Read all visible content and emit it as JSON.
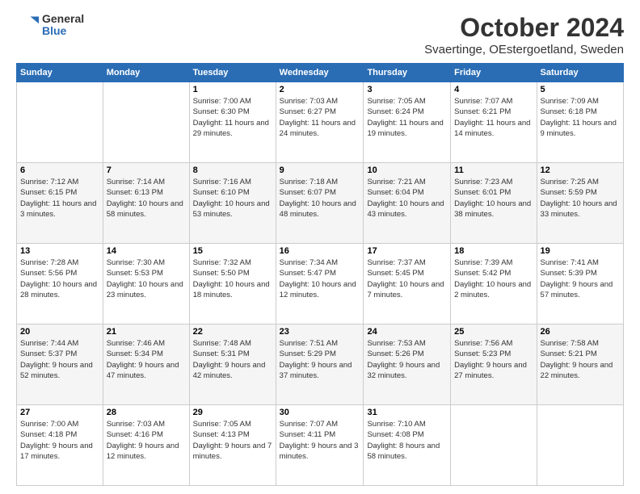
{
  "logo": {
    "general": "General",
    "blue": "Blue"
  },
  "title": "October 2024",
  "subtitle": "Svaertinge, OEstergoetland, Sweden",
  "days_header": [
    "Sunday",
    "Monday",
    "Tuesday",
    "Wednesday",
    "Thursday",
    "Friday",
    "Saturday"
  ],
  "weeks": [
    [
      {
        "num": "",
        "sunrise": "",
        "sunset": "",
        "daylight": ""
      },
      {
        "num": "",
        "sunrise": "",
        "sunset": "",
        "daylight": ""
      },
      {
        "num": "1",
        "sunrise": "Sunrise: 7:00 AM",
        "sunset": "Sunset: 6:30 PM",
        "daylight": "Daylight: 11 hours and 29 minutes."
      },
      {
        "num": "2",
        "sunrise": "Sunrise: 7:03 AM",
        "sunset": "Sunset: 6:27 PM",
        "daylight": "Daylight: 11 hours and 24 minutes."
      },
      {
        "num": "3",
        "sunrise": "Sunrise: 7:05 AM",
        "sunset": "Sunset: 6:24 PM",
        "daylight": "Daylight: 11 hours and 19 minutes."
      },
      {
        "num": "4",
        "sunrise": "Sunrise: 7:07 AM",
        "sunset": "Sunset: 6:21 PM",
        "daylight": "Daylight: 11 hours and 14 minutes."
      },
      {
        "num": "5",
        "sunrise": "Sunrise: 7:09 AM",
        "sunset": "Sunset: 6:18 PM",
        "daylight": "Daylight: 11 hours and 9 minutes."
      }
    ],
    [
      {
        "num": "6",
        "sunrise": "Sunrise: 7:12 AM",
        "sunset": "Sunset: 6:15 PM",
        "daylight": "Daylight: 11 hours and 3 minutes."
      },
      {
        "num": "7",
        "sunrise": "Sunrise: 7:14 AM",
        "sunset": "Sunset: 6:13 PM",
        "daylight": "Daylight: 10 hours and 58 minutes."
      },
      {
        "num": "8",
        "sunrise": "Sunrise: 7:16 AM",
        "sunset": "Sunset: 6:10 PM",
        "daylight": "Daylight: 10 hours and 53 minutes."
      },
      {
        "num": "9",
        "sunrise": "Sunrise: 7:18 AM",
        "sunset": "Sunset: 6:07 PM",
        "daylight": "Daylight: 10 hours and 48 minutes."
      },
      {
        "num": "10",
        "sunrise": "Sunrise: 7:21 AM",
        "sunset": "Sunset: 6:04 PM",
        "daylight": "Daylight: 10 hours and 43 minutes."
      },
      {
        "num": "11",
        "sunrise": "Sunrise: 7:23 AM",
        "sunset": "Sunset: 6:01 PM",
        "daylight": "Daylight: 10 hours and 38 minutes."
      },
      {
        "num": "12",
        "sunrise": "Sunrise: 7:25 AM",
        "sunset": "Sunset: 5:59 PM",
        "daylight": "Daylight: 10 hours and 33 minutes."
      }
    ],
    [
      {
        "num": "13",
        "sunrise": "Sunrise: 7:28 AM",
        "sunset": "Sunset: 5:56 PM",
        "daylight": "Daylight: 10 hours and 28 minutes."
      },
      {
        "num": "14",
        "sunrise": "Sunrise: 7:30 AM",
        "sunset": "Sunset: 5:53 PM",
        "daylight": "Daylight: 10 hours and 23 minutes."
      },
      {
        "num": "15",
        "sunrise": "Sunrise: 7:32 AM",
        "sunset": "Sunset: 5:50 PM",
        "daylight": "Daylight: 10 hours and 18 minutes."
      },
      {
        "num": "16",
        "sunrise": "Sunrise: 7:34 AM",
        "sunset": "Sunset: 5:47 PM",
        "daylight": "Daylight: 10 hours and 12 minutes."
      },
      {
        "num": "17",
        "sunrise": "Sunrise: 7:37 AM",
        "sunset": "Sunset: 5:45 PM",
        "daylight": "Daylight: 10 hours and 7 minutes."
      },
      {
        "num": "18",
        "sunrise": "Sunrise: 7:39 AM",
        "sunset": "Sunset: 5:42 PM",
        "daylight": "Daylight: 10 hours and 2 minutes."
      },
      {
        "num": "19",
        "sunrise": "Sunrise: 7:41 AM",
        "sunset": "Sunset: 5:39 PM",
        "daylight": "Daylight: 9 hours and 57 minutes."
      }
    ],
    [
      {
        "num": "20",
        "sunrise": "Sunrise: 7:44 AM",
        "sunset": "Sunset: 5:37 PM",
        "daylight": "Daylight: 9 hours and 52 minutes."
      },
      {
        "num": "21",
        "sunrise": "Sunrise: 7:46 AM",
        "sunset": "Sunset: 5:34 PM",
        "daylight": "Daylight: 9 hours and 47 minutes."
      },
      {
        "num": "22",
        "sunrise": "Sunrise: 7:48 AM",
        "sunset": "Sunset: 5:31 PM",
        "daylight": "Daylight: 9 hours and 42 minutes."
      },
      {
        "num": "23",
        "sunrise": "Sunrise: 7:51 AM",
        "sunset": "Sunset: 5:29 PM",
        "daylight": "Daylight: 9 hours and 37 minutes."
      },
      {
        "num": "24",
        "sunrise": "Sunrise: 7:53 AM",
        "sunset": "Sunset: 5:26 PM",
        "daylight": "Daylight: 9 hours and 32 minutes."
      },
      {
        "num": "25",
        "sunrise": "Sunrise: 7:56 AM",
        "sunset": "Sunset: 5:23 PM",
        "daylight": "Daylight: 9 hours and 27 minutes."
      },
      {
        "num": "26",
        "sunrise": "Sunrise: 7:58 AM",
        "sunset": "Sunset: 5:21 PM",
        "daylight": "Daylight: 9 hours and 22 minutes."
      }
    ],
    [
      {
        "num": "27",
        "sunrise": "Sunrise: 7:00 AM",
        "sunset": "Sunset: 4:18 PM",
        "daylight": "Daylight: 9 hours and 17 minutes."
      },
      {
        "num": "28",
        "sunrise": "Sunrise: 7:03 AM",
        "sunset": "Sunset: 4:16 PM",
        "daylight": "Daylight: 9 hours and 12 minutes."
      },
      {
        "num": "29",
        "sunrise": "Sunrise: 7:05 AM",
        "sunset": "Sunset: 4:13 PM",
        "daylight": "Daylight: 9 hours and 7 minutes."
      },
      {
        "num": "30",
        "sunrise": "Sunrise: 7:07 AM",
        "sunset": "Sunset: 4:11 PM",
        "daylight": "Daylight: 9 hours and 3 minutes."
      },
      {
        "num": "31",
        "sunrise": "Sunrise: 7:10 AM",
        "sunset": "Sunset: 4:08 PM",
        "daylight": "Daylight: 8 hours and 58 minutes."
      },
      {
        "num": "",
        "sunrise": "",
        "sunset": "",
        "daylight": ""
      },
      {
        "num": "",
        "sunrise": "",
        "sunset": "",
        "daylight": ""
      }
    ]
  ]
}
